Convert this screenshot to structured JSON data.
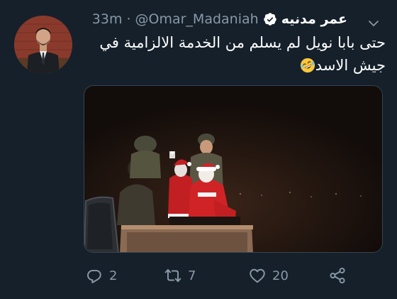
{
  "tweet": {
    "display_name": "عمر مدنيه",
    "handle": "@Omar_Madaniah",
    "separator": "·",
    "timestamp": "33m",
    "text_line1": "حتى بابا نويل لم يسلم من الخدمة الالزامية في",
    "text_line2": "جيش الاسد",
    "emoji": "rolling-on-the-floor-laughing",
    "verified": true
  },
  "actions": {
    "reply_count": "2",
    "retweet_count": "7",
    "like_count": "20"
  },
  "icons": {
    "verified": "verified-badge-icon",
    "menu": "chevron-down-icon",
    "reply": "reply-icon",
    "retweet": "retweet-icon",
    "like": "heart-icon",
    "share": "share-icon"
  },
  "colors": {
    "background": "#15202b",
    "secondary_text": "#8899a6",
    "primary_text": "#ffffff"
  }
}
